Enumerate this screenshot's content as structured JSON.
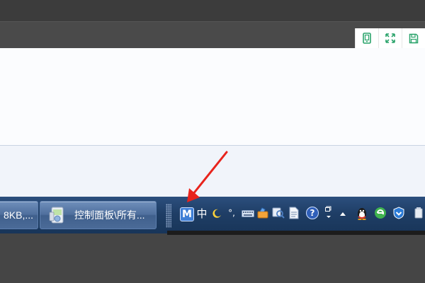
{
  "toolbar": {
    "buttons": [
      {
        "icon": "tablet-icon"
      },
      {
        "icon": "fullscreen-icon"
      },
      {
        "icon": "save-icon"
      }
    ],
    "accent": "#2aa36b"
  },
  "taskbar": {
    "windows": [
      {
        "label": "8KB,..."
      },
      {
        "label": "控制面板\\所有..."
      }
    ]
  },
  "tray": {
    "ime_logo": "M",
    "ime_mode": "中",
    "punct": "°,",
    "help": "?"
  },
  "annotation": {
    "arrow_color": "#e8231c"
  }
}
